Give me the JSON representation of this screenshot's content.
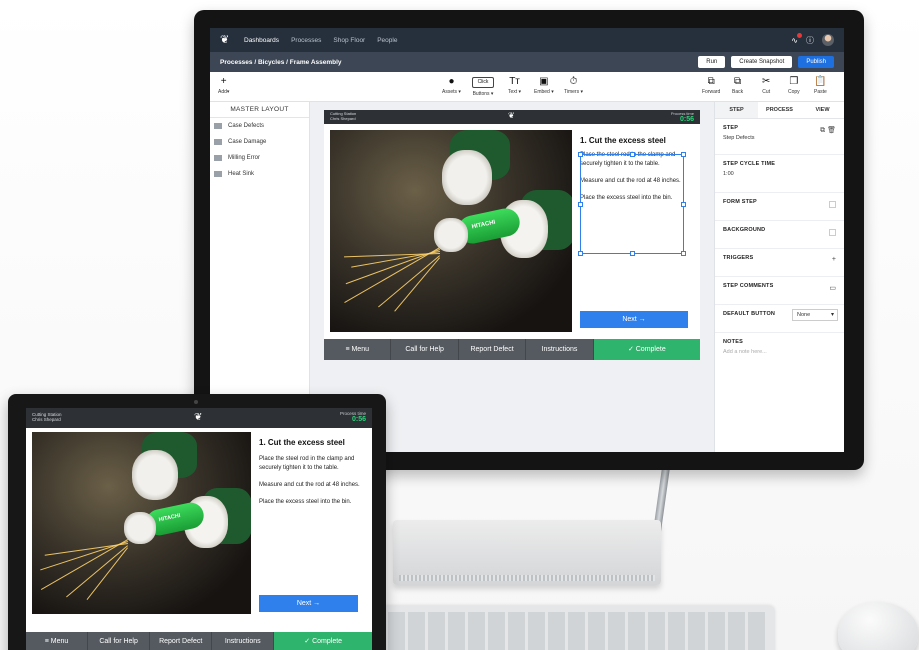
{
  "nav": {
    "items": [
      "Dashboards",
      "Processes",
      "Shop Floor",
      "People"
    ]
  },
  "breadcrumb": "Processes / Bicycles / Frame Assembly",
  "actions": {
    "run": "Run",
    "snapshot": "Create Snapshot",
    "publish": "Publish"
  },
  "toolbar": {
    "add": "Add",
    "assets": "Assets",
    "buttons": "Buttons",
    "click_pill": "Click",
    "text": "Text",
    "embed": "Embed",
    "timers": "Timers",
    "forward": "Forward",
    "back": "Back",
    "cut": "Cut",
    "copy": "Copy",
    "paste": "Paste",
    "text_glyph": "Tт"
  },
  "sidebar": {
    "title": "MASTER LAYOUT",
    "items": [
      "Case Defects",
      "Case Damage",
      "Milling Error",
      "Heat Sink"
    ]
  },
  "panel": {
    "tabs": [
      "STEP",
      "PROCESS",
      "VIEW"
    ],
    "step_label": "STEP",
    "step_value": "Step Defects",
    "cycle_label": "STEP CYCLE TIME",
    "cycle_value": "1:00",
    "form_label": "FORM STEP",
    "background_label": "BACKGROUND",
    "triggers_label": "TRIGGERS",
    "comments_label": "STEP COMMENTS",
    "default_button_label": "DEFAULT BUTTON",
    "default_button_value": "None",
    "notes_label": "NOTES",
    "notes_placeholder": "Add a note here..."
  },
  "station": {
    "location_line1": "Cutting Station",
    "location_line2": "Chris Shepard",
    "timer_label": "Process time",
    "timer_value": "0:56",
    "photo_brand": "HITACHI",
    "instruction_title": "1.  Cut the excess steel",
    "instructions": [
      "Place the steel rod in the clamp and securely tighten it to the table.",
      "Measure and cut the rod at 48 inches.",
      " Place the excess steel into the bin."
    ],
    "next_label": "Next →",
    "footer": [
      "≡ Menu",
      "Call for Help",
      "Report Defect",
      "Instructions",
      "✓ Complete"
    ]
  }
}
